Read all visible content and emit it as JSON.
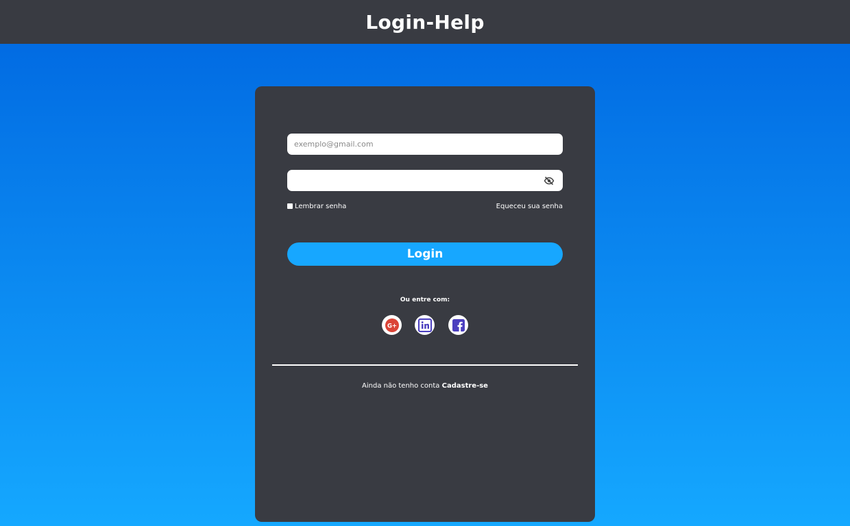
{
  "header": {
    "title": "Login-Help"
  },
  "form": {
    "email_placeholder": "exemplo@gmail.com",
    "email_value": "",
    "password_value": "",
    "remember_label": "Lembrar senha",
    "forgot_label": "Equeceu sua senha",
    "login_label": "Login"
  },
  "social": {
    "label": "Ou entre com:",
    "providers": [
      {
        "icon": "google-plus-icon",
        "color": "#db4437"
      },
      {
        "icon": "linkedin-icon",
        "color": "#4b3fbf"
      },
      {
        "icon": "facebook-icon",
        "color": "#4b3fbf"
      }
    ]
  },
  "signup": {
    "prompt": "Ainda não tenho conta",
    "link_label": "Cadastre-se"
  },
  "colors": {
    "background_top": "#0066e0",
    "background_bottom": "#15a8ff",
    "panel": "#393b42",
    "accent": "#17a7ff"
  }
}
